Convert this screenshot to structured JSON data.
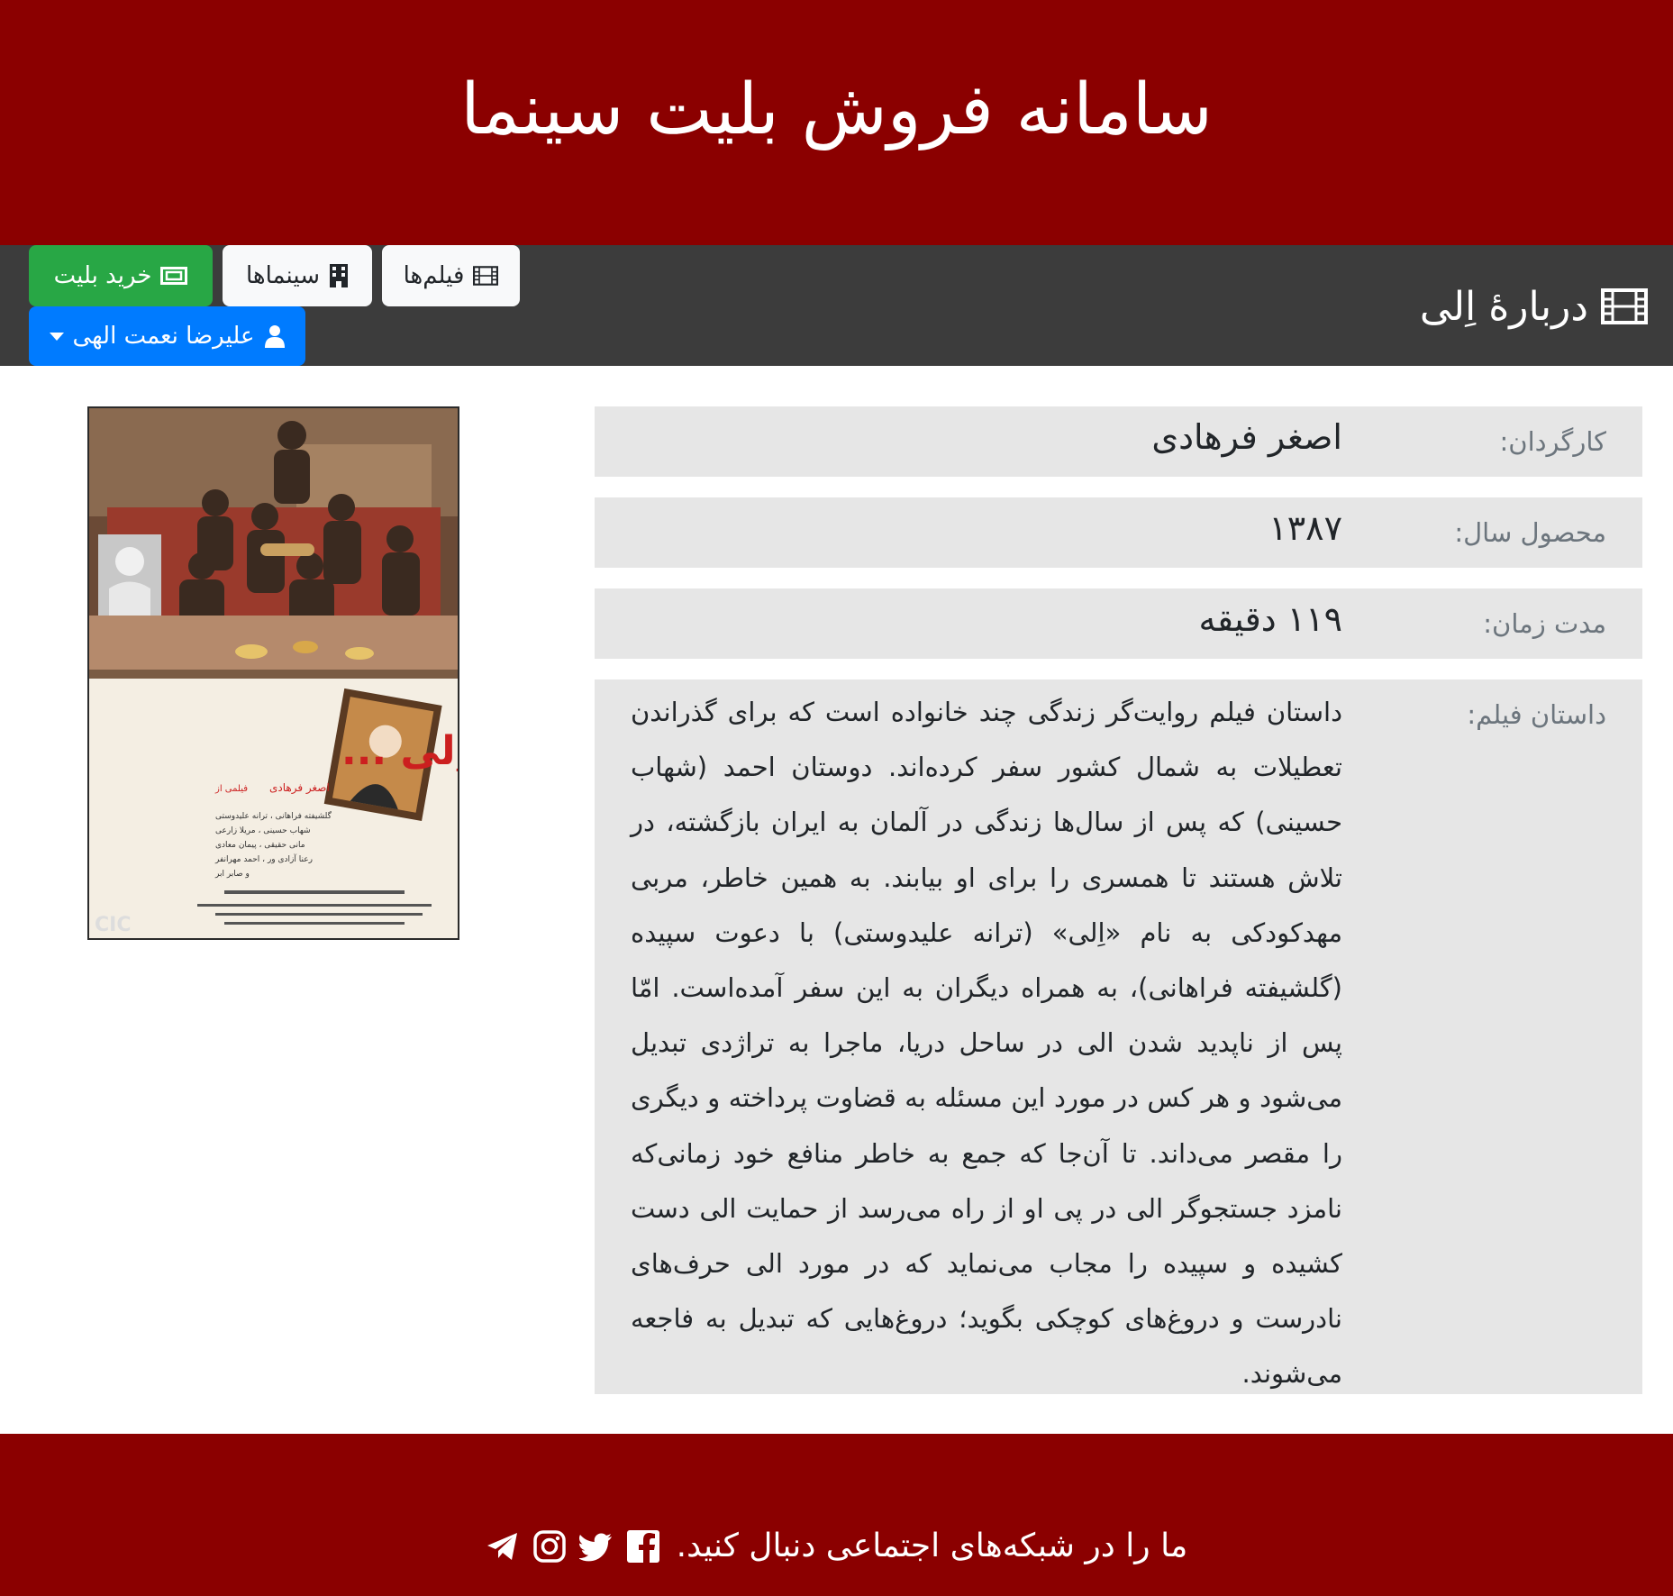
{
  "header": {
    "title": "سامانه فروش بلیت سینما"
  },
  "navbar": {
    "brand": "دربارهٔ اِلی",
    "films_label": "فیلم‌ها",
    "cinemas_label": "سینماها",
    "buy_label": "خرید بلیت",
    "user_label": "علیرضا نعمت الهی"
  },
  "movie": {
    "director_label": "کارگردان:",
    "director": "اصغر فرهادی",
    "year_label": "محصول سال:",
    "year": "۱۳۸۷",
    "duration_label": "مدت زمان:",
    "duration": "۱۱۹ دقیقه",
    "story_label": "داستان فیلم:",
    "story": "داستان فیلم روایت‌گر زندگی چند خانواده است که برای گذراندن تعطیلات به شمال کشور سفر کرده‌اند. دوستان احمد (شهاب حسینی) که پس از سال‌ها زندگی در آلمان به ایران بازگشته، در تلاش هستند تا همسری را برای او بیابند. به همین خاطر، مربی مهدکودکی به نام «اِلی» (ترانه علیدوستی) با دعوت سپیده (گلشیفته فراهانی)، به همراه دیگران به این سفر آمده‌است. امّا پس از ناپدید شدن الی در ساحل دریا، ماجرا به تراژدی تبدیل می‌شود و هر کس در مورد این مسئله به قضاوت پرداخته و دیگری را مقصر می‌داند. تا آن‌جا که جمع به خاطر منافع خود زمانی‌که نامزد جستجوگر الی در پی او از راه می‌رسد از حمایت الی دست کشیده و سپیده را مجاب می‌نماید که در مورد الی حرف‌های نادرست و دروغ‌های کوچکی بگوید؛ دروغ‌هایی که تبدیل به فاجعه می‌شوند."
  },
  "poster": {
    "title": "درباره اِلی ...",
    "credit_prefix": "فیلمی از",
    "credit_name": "اصغر فرهادی",
    "cast": [
      "گلشیفته فراهانی ، ترانه علیدوستی",
      "شهاب حسینی ، مریلا زارعی",
      "مانی حقیقی ، پیمان معادی",
      "رعنا آزادی ور ، احمد مهرانفر",
      "و صابر ابر"
    ],
    "logo": "CIC"
  },
  "footer": {
    "text": "ما را در شبکه‌های اجتماعی دنبال کنید."
  },
  "icons": [
    "film-icon",
    "building-icon",
    "ticket-icon",
    "user-icon",
    "facebook-icon",
    "twitter-icon",
    "instagram-icon",
    "telegram-icon"
  ],
  "colors": {
    "header_bg": "#8b0000",
    "navbar_bg": "#3c3c3c",
    "success": "#28a745",
    "primary": "#007bff",
    "row_bg": "#e6e6e6"
  }
}
